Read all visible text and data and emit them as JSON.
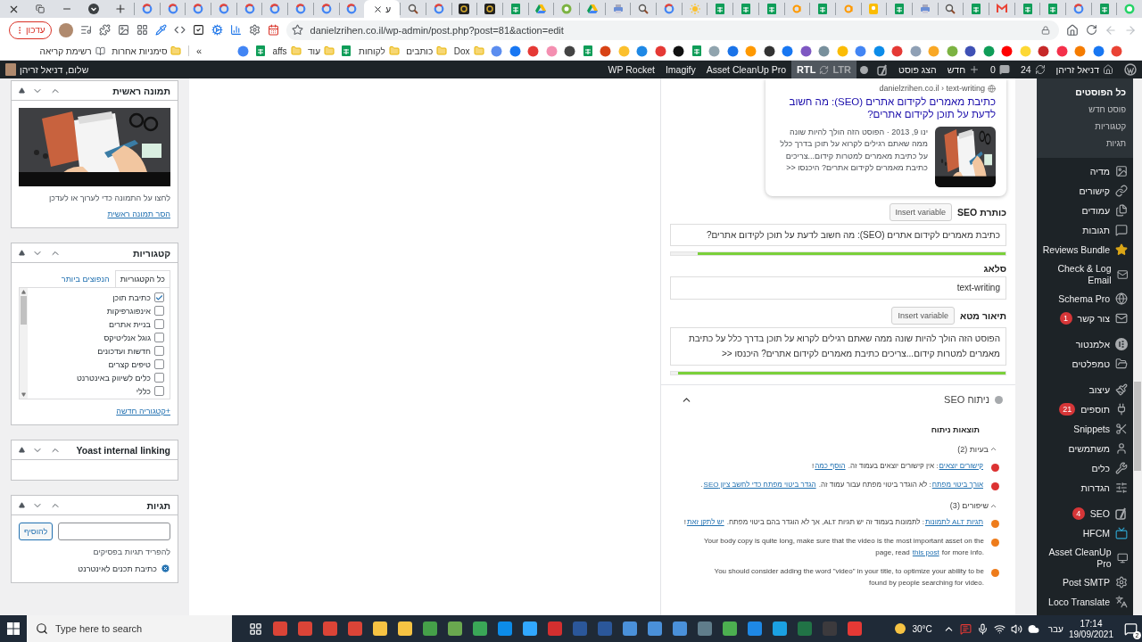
{
  "browser": {
    "tabs": [
      {
        "kind": "google",
        "selected": false
      },
      {
        "kind": "google",
        "selected": false
      },
      {
        "kind": "google",
        "selected": false
      },
      {
        "kind": "google",
        "selected": false
      },
      {
        "kind": "google",
        "selected": false
      },
      {
        "kind": "google",
        "selected": false
      },
      {
        "kind": "google",
        "selected": false
      },
      {
        "kind": "google",
        "selected": false
      },
      {
        "kind": "google",
        "selected": false
      },
      {
        "kind": "page",
        "label": "ע",
        "selected": true
      },
      {
        "kind": "search",
        "selected": false
      },
      {
        "kind": "google",
        "selected": false
      },
      {
        "kind": "dark",
        "selected": false
      },
      {
        "kind": "dark",
        "selected": false
      },
      {
        "kind": "sheets",
        "selected": false
      },
      {
        "kind": "drive",
        "selected": false
      },
      {
        "kind": "green",
        "selected": false
      },
      {
        "kind": "drive",
        "selected": false
      },
      {
        "kind": "printer",
        "selected": false
      },
      {
        "kind": "search",
        "selected": false
      },
      {
        "kind": "google",
        "selected": false
      },
      {
        "kind": "sun",
        "selected": false
      },
      {
        "kind": "sheets",
        "selected": false
      },
      {
        "kind": "sheets",
        "selected": false
      },
      {
        "kind": "sheets",
        "selected": false
      },
      {
        "kind": "amazon",
        "selected": false
      },
      {
        "kind": "sheets",
        "selected": false
      },
      {
        "kind": "amazon",
        "selected": false
      },
      {
        "kind": "keep",
        "selected": false
      },
      {
        "kind": "sheets",
        "selected": false
      },
      {
        "kind": "printer",
        "selected": false
      },
      {
        "kind": "search",
        "selected": false
      },
      {
        "kind": "sheets",
        "selected": false
      },
      {
        "kind": "gmail",
        "selected": false
      },
      {
        "kind": "sheets",
        "selected": false
      },
      {
        "kind": "sheets",
        "selected": false
      },
      {
        "kind": "google",
        "selected": false
      },
      {
        "kind": "sheets",
        "selected": false
      },
      {
        "kind": "whatsapp",
        "selected": false
      }
    ],
    "update_button": "עדכון",
    "url": "danielzrihen.co.il/wp-admin/post.php?post=81&action=edit",
    "bookmarks": [
      {
        "kind": "site",
        "color": "#ea4335"
      },
      {
        "kind": "site",
        "color": "#1877f2"
      },
      {
        "kind": "site",
        "color": "#f57c00"
      },
      {
        "kind": "site",
        "color": "#f4304a"
      },
      {
        "kind": "site",
        "color": "#c62828"
      },
      {
        "kind": "site",
        "color": "#fdd835"
      },
      {
        "kind": "site",
        "color": "#ff0000"
      },
      {
        "kind": "site",
        "color": "#0f9d58"
      },
      {
        "kind": "site",
        "color": "#3f51b5"
      },
      {
        "kind": "site",
        "color": "#7cb342"
      },
      {
        "kind": "site",
        "color": "#f9a825"
      },
      {
        "kind": "site",
        "color": "#8fa0b5"
      },
      {
        "kind": "site",
        "color": "#e53935"
      },
      {
        "kind": "site",
        "color": "#0c8ce9"
      },
      {
        "kind": "site",
        "color": "#4285f4"
      },
      {
        "kind": "site",
        "color": "#fbbc04"
      },
      {
        "kind": "site",
        "color": "#78909c"
      },
      {
        "kind": "site",
        "color": "#7e57c2"
      },
      {
        "kind": "site",
        "color": "#1877f2"
      },
      {
        "kind": "site",
        "color": "#333333"
      },
      {
        "kind": "site",
        "color": "#ff9900"
      },
      {
        "kind": "site",
        "color": "#1a73e8"
      },
      {
        "kind": "site",
        "color": "#90a4ae"
      },
      {
        "kind": "sheets"
      },
      {
        "kind": "site",
        "color": "#111111"
      },
      {
        "kind": "site",
        "color": "#e53935"
      },
      {
        "kind": "site",
        "color": "#1e88e5"
      },
      {
        "kind": "site",
        "color": "#fbc02d"
      },
      {
        "kind": "site",
        "color": "#d84315"
      },
      {
        "kind": "sheets"
      },
      {
        "kind": "site",
        "color": "#444444"
      },
      {
        "kind": "site",
        "color": "#f48fb1"
      },
      {
        "kind": "site",
        "color": "#e53935"
      },
      {
        "kind": "site",
        "color": "#1877f2"
      },
      {
        "kind": "site",
        "color": "#5b8def"
      },
      {
        "kind": "folder",
        "label": "Dox"
      },
      {
        "kind": "folder",
        "label": "כותבים"
      },
      {
        "kind": "folder",
        "label": "לקוחות"
      },
      {
        "kind": "sheets"
      },
      {
        "kind": "folder",
        "label": "עוד"
      },
      {
        "kind": "folder",
        "label": "affs"
      },
      {
        "kind": "sheets"
      },
      {
        "kind": "site",
        "color": "#4285f4"
      },
      {
        "kind": "more",
        "label": "»"
      },
      {
        "kind": "folder",
        "label": "סימניות אחרות"
      },
      {
        "kind": "reading",
        "label": "רשימת קריאה"
      }
    ]
  },
  "admin_bar": {
    "site": "דניאל זריהן",
    "updates": "24",
    "comments": "0",
    "new": "חדש",
    "view_post": "הצג פוסט",
    "direction": [
      {
        "label": "LTR",
        "selected": false
      },
      {
        "label": "RTL",
        "selected": true
      }
    ],
    "plugins": [
      "Asset CleanUp Pro",
      "Imagify",
      "WP Rocket"
    ],
    "greeting": "שלום, דניאל זריהן"
  },
  "admin_menu": {
    "submenu": [
      {
        "label": "כל הפוסטים",
        "selected": true
      },
      {
        "label": "פוסט חדש",
        "selected": false
      },
      {
        "label": "קטגוריות",
        "selected": false
      },
      {
        "label": "תגיות",
        "selected": false
      }
    ],
    "groups": [
      [
        {
          "label": "מדיה",
          "kind": "media"
        },
        {
          "label": "קישורים",
          "kind": "link"
        },
        {
          "label": "עמודים",
          "kind": "pages"
        },
        {
          "label": "תגובות",
          "kind": "comments"
        },
        {
          "label": "Reviews Bundle",
          "kind": "star"
        },
        {
          "label": "Check & Log Email",
          "kind": "mail"
        },
        {
          "label": "Schema Pro",
          "kind": "globe"
        },
        {
          "label": "צור קשר",
          "kind": "mail",
          "badge": "1"
        }
      ],
      [
        {
          "label": "אלמנטור",
          "kind": "elementor"
        },
        {
          "label": "טמפלטים",
          "kind": "folder"
        }
      ],
      [
        {
          "label": "עיצוב",
          "kind": "brush"
        },
        {
          "label": "תוספים",
          "kind": "plug",
          "badge": "21"
        },
        {
          "label": "Snippets",
          "kind": "scissors"
        },
        {
          "label": "משתמשים",
          "kind": "user"
        },
        {
          "label": "כלים",
          "kind": "wrench"
        },
        {
          "label": "הגדרות",
          "kind": "sliders"
        }
      ],
      [
        {
          "label": "SEO",
          "kind": "yoast",
          "badge": "4"
        },
        {
          "label": "HFCM",
          "kind": "tv"
        },
        {
          "label": "Asset CleanUp Pro",
          "kind": "monitor"
        },
        {
          "label": "Post SMTP",
          "kind": "gear"
        },
        {
          "label": "Loco Translate",
          "kind": "translate"
        }
      ]
    ]
  },
  "seo": {
    "preview": {
      "breadcrumb": "danielzrihen.co.il › text-writing",
      "title": "כתיבת מאמרים לקידום אתרים (SEO): מה חשוב לדעת על תוכן לקידום אתרים?",
      "snippet": "ינו 9, 2013 · הפוסט הזה הולך להיות שונה ממה שאתם רגילים לקרוא על תוכן בדרך כלל על כתיבת מאמרים למטרות קידום...צריכים כתיבת מאמרים לקידום אתרים? היכנסו <<"
    },
    "fields": [
      {
        "label": "כותרת SEO",
        "button": "Insert variable",
        "value": "כתיבת מאמרים לקידום אתרים (SEO): מה חשוב לדעת על תוכן לקידום אתרים?",
        "level": 0.92
      },
      {
        "label": "סלאג",
        "value": "text-writing"
      },
      {
        "label": "תיאור מטא",
        "button": "Insert variable",
        "value": "הפוסט הזה הולך להיות שונה ממה שאתם רגילים לקרוא על תוכן בדרך כלל על כתיבת מאמרים למטרות קידום...צריכים כתיבת מאמרים לקידום אתרים? היכנסו <<",
        "level": 0.98
      }
    ],
    "analysis": {
      "title": "ניתוח SEO",
      "expanded": true,
      "results_title": "תוצאות ניתוח",
      "groups": [
        {
          "title": "בעיות (2)",
          "expanded": true,
          "items": [
            {
              "color": "#dc3232",
              "lines": [
                [
                  {
                    "text": "קישורים יוצאים",
                    "link": true
                  },
                  {
                    "text": ": אין קישורים יוצאים בעמוד זה. ",
                    "link": false
                  },
                  {
                    "text": "הוסף כמה",
                    "link": true
                  },
                  {
                    "text": "!",
                    "link": false
                  }
                ]
              ]
            },
            {
              "color": "#dc3232",
              "lines": [
                [
                  {
                    "text": "אורך ביטוי מפתח",
                    "link": true
                  },
                  {
                    "text": ": לא הוגדר ביטוי מפתח עבור עמוד זה. ",
                    "link": false
                  },
                  {
                    "text": "הגדר ביטוי מפתח כדי לחשב ציון SEO",
                    "link": true
                  },
                  {
                    "text": ".",
                    "link": false
                  }
                ]
              ]
            }
          ]
        },
        {
          "title": "שיפורים (3)",
          "expanded": true,
          "items": [
            {
              "color": "#ee7c1b",
              "lines": [
                [
                  {
                    "text": "תגיות ALT לתמונות",
                    "link": true
                  },
                  {
                    "text": ": לתמונות בעמוד זה יש תגיות ALT, אך לא הוגדר בהם ביטוי מפתח. ",
                    "link": false
                  },
                  {
                    "text": "יש לתקן זאת",
                    "link": true
                  },
                  {
                    "text": "!",
                    "link": false
                  }
                ]
              ]
            },
            {
              "color": "#ee7c1b",
              "lines": [
                [
                  {
                    "text": "Your body copy is quite long, make sure that the video is the most important asset on the",
                    "link": false
                  }
                ],
                {
                  "before": "page, read ",
                  "link": "this post",
                  "after": " for more info."
                }
              ]
            },
            {
              "color": "#ee7c1b",
              "lines": [
                [
                  {
                    "text": "You should consider adding the word \"video\" in your title, to optimize your ability to be",
                    "link": false
                  }
                ],
                [
                  {
                    "text": "found by people searching for video.",
                    "link": false
                  }
                ]
              ]
            }
          ]
        }
      ]
    }
  },
  "sidebar": {
    "featured_image": {
      "title": "תמונה ראשית",
      "hint": "לחצו על התמונה כדי לערוך או לעדכן",
      "remove_link": "הסר תמונה ראשית"
    },
    "categories": {
      "title": "קטגוריות",
      "tabs": [
        {
          "label": "כל הקטגוריות",
          "selected": true
        },
        {
          "label": "הנפוצים ביותר",
          "selected": false
        }
      ],
      "items": [
        {
          "label": "כתיבת תוכן",
          "checked": true
        },
        {
          "label": "אינפוגרפיקות",
          "checked": false
        },
        {
          "label": "בניית אתרים",
          "checked": false
        },
        {
          "label": "גוגל אנליטיקס",
          "checked": false
        },
        {
          "label": "חדשות ועדכונים",
          "checked": false
        },
        {
          "label": "טיפים קצרים",
          "checked": false
        },
        {
          "label": "כלים לשיווק באינטרנט",
          "checked": false
        },
        {
          "label": "כללי",
          "checked": false
        }
      ],
      "add_link": "+קטגוריה חדשה"
    },
    "internal_linking": {
      "title": "Yoast internal linking"
    },
    "tags": {
      "title": "תגיות",
      "add_button": "להוסיף",
      "hint": "להפריד תגיות בפסיקים",
      "tags": [
        "כתיבת תכנים לאינטרנט"
      ]
    }
  },
  "taskbar": {
    "search_placeholder": "Type here to search",
    "apps": [
      {
        "color": "#db4437"
      },
      {
        "color": "#db4437"
      },
      {
        "color": "#db4437"
      },
      {
        "color": "#db4437"
      },
      {
        "color": "#f6c343"
      },
      {
        "color": "#f6c343"
      },
      {
        "color": "#45a049"
      },
      {
        "color": "#6aa84f"
      },
      {
        "color": "#3aa757"
      },
      {
        "color": "#0c8ce9"
      },
      {
        "color": "#31a8ff"
      },
      {
        "color": "#d32f2f"
      },
      {
        "color": "#2b579a"
      },
      {
        "color": "#2b579a"
      },
      {
        "color": "#4a90d9"
      },
      {
        "color": "#4a90d9"
      },
      {
        "color": "#4a90d9"
      },
      {
        "color": "#607d8b"
      },
      {
        "color": "#4caf50"
      },
      {
        "color": "#1e88e5"
      },
      {
        "color": "#1ba1e2"
      },
      {
        "color": "#217346"
      },
      {
        "color": "#3c3a3d"
      },
      {
        "color": "#e53935"
      }
    ],
    "temperature": "30°C",
    "language": "עבר",
    "time": "17:14",
    "date": "19/09/2021",
    "notifications": "2"
  }
}
